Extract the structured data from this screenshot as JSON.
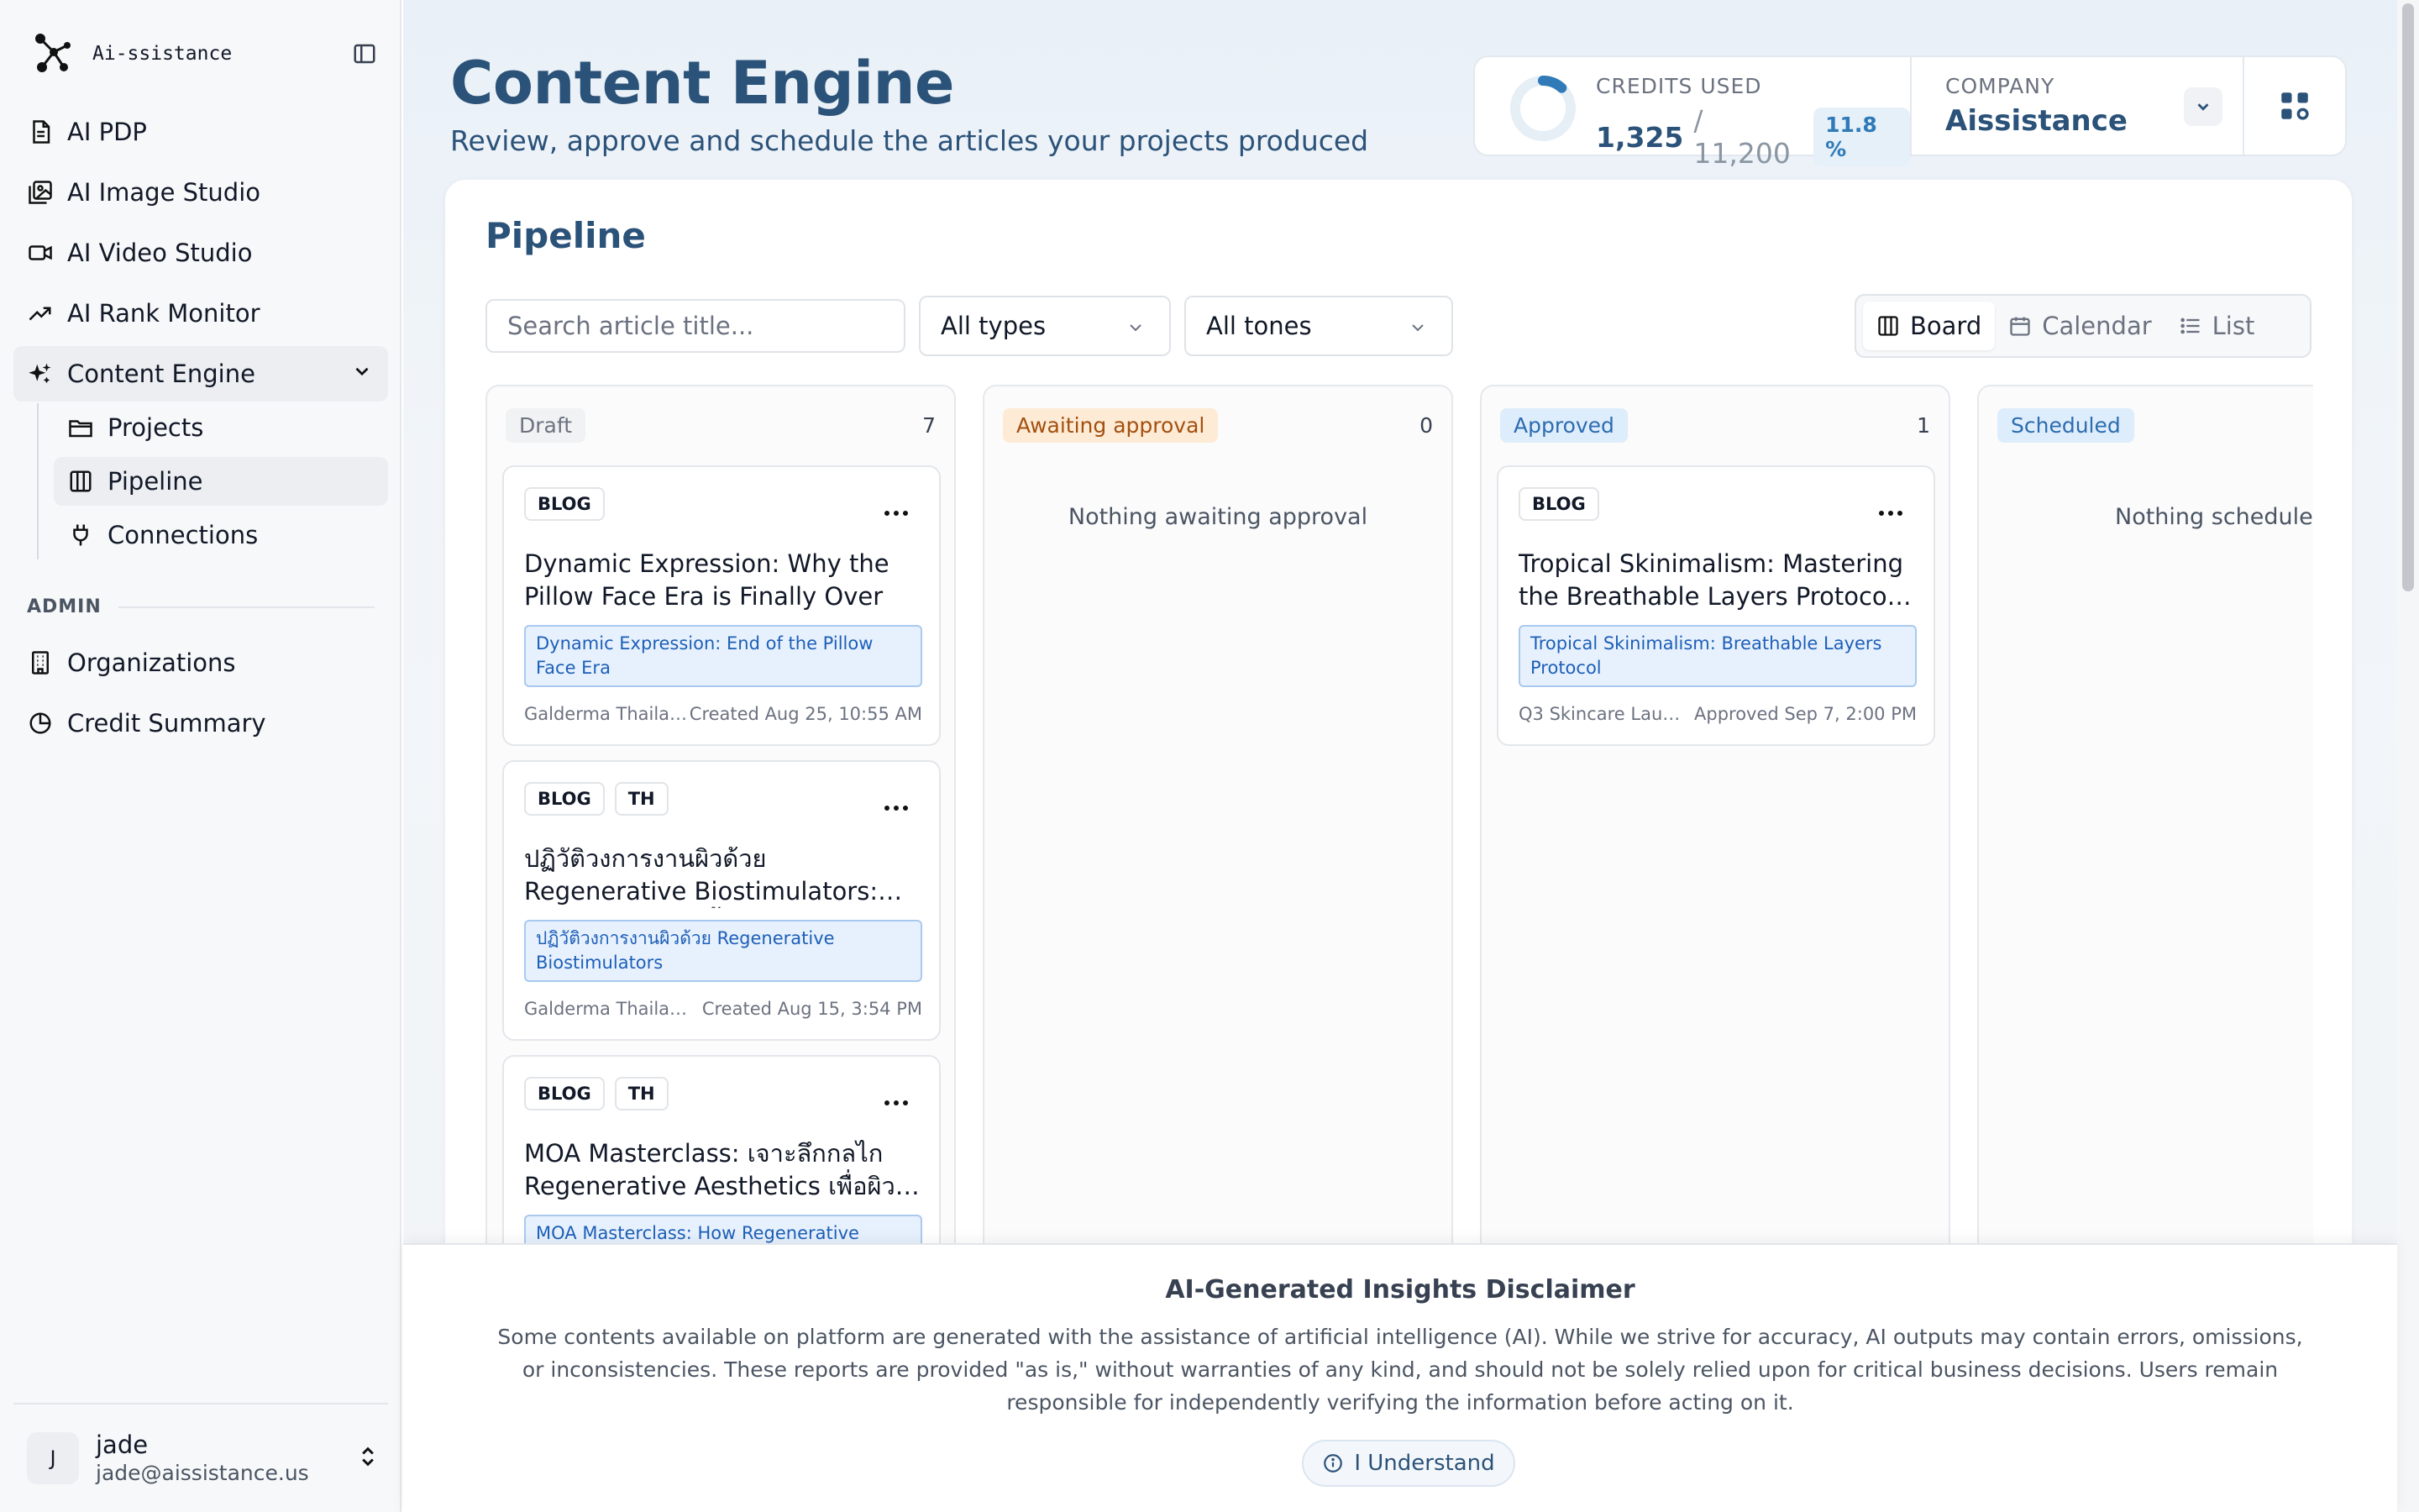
{
  "brand": {
    "name": "Ai-ssistance"
  },
  "sidebar": {
    "items": [
      {
        "label": "AI PDP",
        "icon": "document-icon"
      },
      {
        "label": "AI Image Studio",
        "icon": "image-icon"
      },
      {
        "label": "AI Video Studio",
        "icon": "video-icon"
      },
      {
        "label": "AI Rank Monitor",
        "icon": "trending-up-icon"
      },
      {
        "label": "Content Engine",
        "icon": "sparkles-icon",
        "expanded": true
      }
    ],
    "sub_items": [
      {
        "label": "Projects",
        "icon": "folder-icon"
      },
      {
        "label": "Pipeline",
        "icon": "kanban-icon",
        "active": true
      },
      {
        "label": "Connections",
        "icon": "plug-icon"
      }
    ],
    "admin_label": "ADMIN",
    "admin_items": [
      {
        "label": "Organizations",
        "icon": "building-icon"
      },
      {
        "label": "Credit Summary",
        "icon": "pie-chart-icon"
      }
    ],
    "user": {
      "initial": "J",
      "name": "jade",
      "email": "jade@aissistance.us"
    }
  },
  "header": {
    "title": "Content Engine",
    "subtitle": "Review, approve and schedule the articles your projects produced",
    "credits": {
      "label": "CREDITS USED",
      "used": "1,325",
      "total": "/ 11,200",
      "percent": "11.8 %",
      "fraction": 0.118
    },
    "company": {
      "label": "COMPANY",
      "name": "Aissistance"
    }
  },
  "pipeline": {
    "title": "Pipeline",
    "search_placeholder": "Search article title...",
    "type_filter": "All types",
    "tone_filter": "All tones",
    "views": [
      "Board",
      "Calendar",
      "List"
    ],
    "active_view": "Board",
    "columns": [
      {
        "status": "Draft",
        "count": "7",
        "cards": [
          {
            "tags": [
              "BLOG"
            ],
            "title": "Dynamic Expression: Why the Pillow Face Era is Finally Over",
            "topic": "Dynamic Expression: End of the Pillow Face Era",
            "project": "Galderma Thailan...",
            "date": "Created Aug 25, 10:55 AM"
          },
          {
            "tags": [
              "BLOG",
              "TH"
            ],
            "title": "ปฏิวัติวงการงานผิวด้วย Regenerative Biostimulators: เจาะลึกนวัตกรรมฟื้นฟูผิว",
            "topic": "ปฏิวัติวงการงานผิวด้วย Regenerative Biostimulators",
            "project": "Galderma Thailand ...",
            "date": "Created Aug 15, 3:54 PM"
          },
          {
            "tags": [
              "BLOG",
              "TH"
            ],
            "title": "MOA Masterclass: เจาะลึกกลไก Regenerative Aesthetics เพื่อผิวอ่อนเยาว์",
            "topic": "MOA Masterclass: How Regenerative",
            "project": "",
            "date": ""
          }
        ]
      },
      {
        "status": "Awaiting approval",
        "count": "0",
        "empty": "Nothing awaiting approval",
        "cards": []
      },
      {
        "status": "Approved",
        "count": "1",
        "cards": [
          {
            "tags": [
              "BLOG"
            ],
            "title": "Tropical Skinimalism: Mastering the Breathable Layers Protocol for Humid Climates",
            "topic": "Tropical Skinimalism: Breathable Layers Protocol",
            "project": "Q3 Skincare Launch",
            "date": "Approved Sep 7, 2:00 PM"
          }
        ]
      },
      {
        "status": "Scheduled",
        "count": "",
        "empty": "Nothing scheduled",
        "cards": []
      }
    ]
  },
  "disclaimer": {
    "title": "AI-Generated Insights Disclaimer",
    "body": "Some contents available on platform are generated with the assistance of artificial intelligence (AI). While we strive for accuracy, AI outputs may contain errors, omissions, or inconsistencies. These reports are provided \"as is,\" without warranties of any kind, and should not be solely relied upon for critical business decisions. Users remain responsible for independently verifying the information before acting on it.",
    "button": "I Understand"
  },
  "colors": {
    "brand": "#2b5279",
    "accent": "#2f7ab7",
    "await": "#fdebd6",
    "approved": "#deedfb"
  }
}
